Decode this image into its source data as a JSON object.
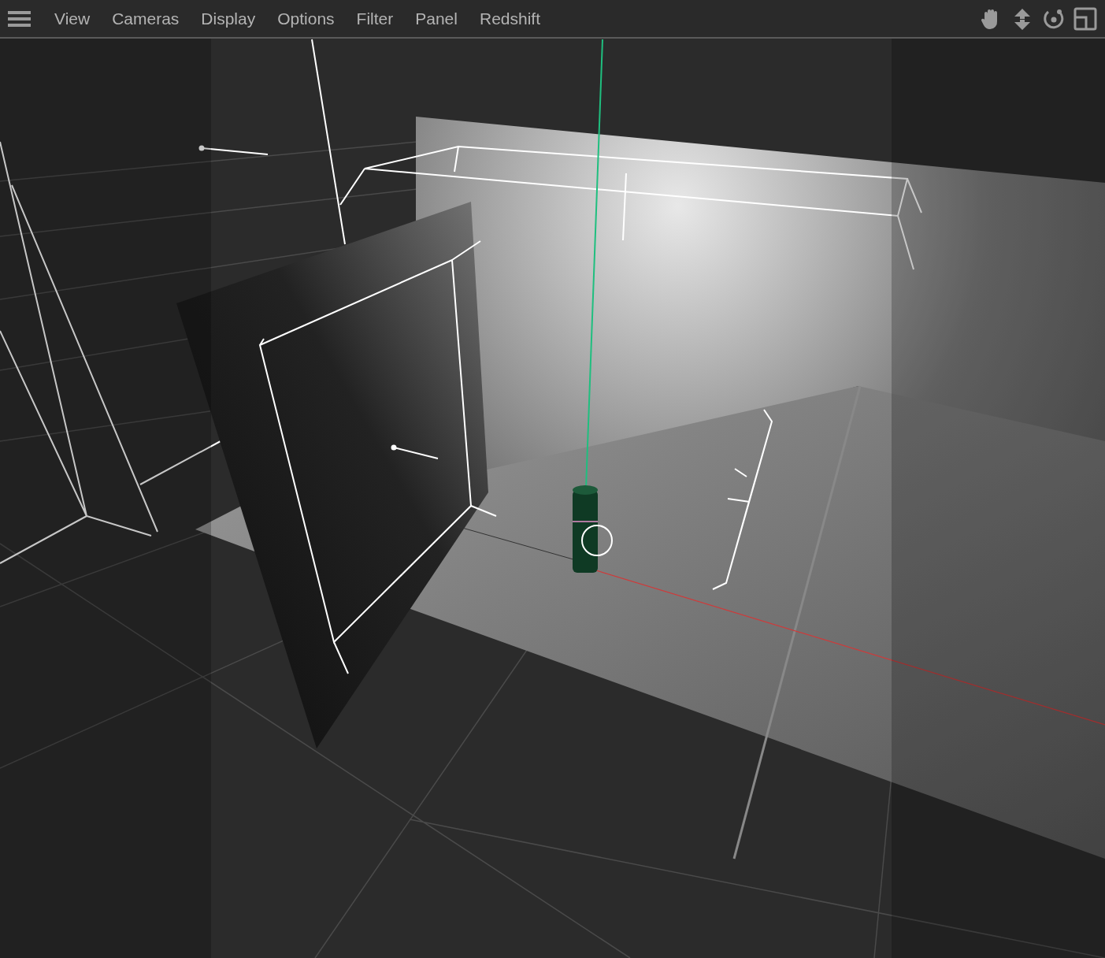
{
  "menu": {
    "items": [
      "View",
      "Cameras",
      "Display",
      "Options",
      "Filter",
      "Panel",
      "Redshift"
    ]
  }
}
